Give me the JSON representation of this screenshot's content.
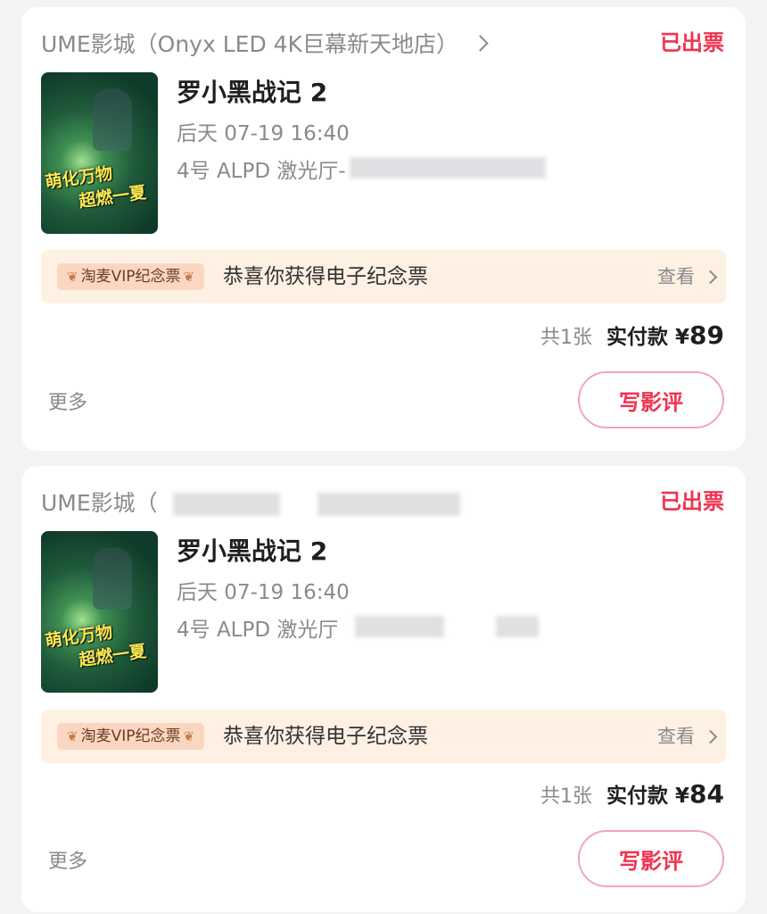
{
  "orders": [
    {
      "cinema": "UME影城（Onyx LED 4K巨幕新天地店）",
      "status": "已出票",
      "poster": {
        "line1": "萌化万物",
        "line2": "超燃一夏"
      },
      "title": "罗小黑战记 2",
      "showtime": "后天 07-19 16:40",
      "hall": "4号 ALPD 激光厅-",
      "vip_badge": "淘麦VIP纪念票",
      "souvenir_text": "恭喜你获得电子纪念票",
      "view_label": "查看",
      "count": "共1张",
      "paid_label": "实付款 ¥",
      "amount": "89",
      "more_label": "更多",
      "review_label": "写影评"
    },
    {
      "cinema": "UME影城（",
      "status": "已出票",
      "poster": {
        "line1": "萌化万物",
        "line2": "超燃一夏"
      },
      "title": "罗小黑战记 2",
      "showtime": "后天 07-19 16:40",
      "hall": "4号 ALPD 激光厅",
      "vip_badge": "淘麦VIP纪念票",
      "souvenir_text": "恭喜你获得电子纪念票",
      "view_label": "查看",
      "count": "共1张",
      "paid_label": "实付款 ¥",
      "amount": "84",
      "more_label": "更多",
      "review_label": "写影评"
    }
  ],
  "colors": {
    "status_red": "#f0334f",
    "souvenir_bg": "#fff0e4",
    "badge_bg": "#fbd7c2",
    "muted_text": "#8a8a8e"
  }
}
